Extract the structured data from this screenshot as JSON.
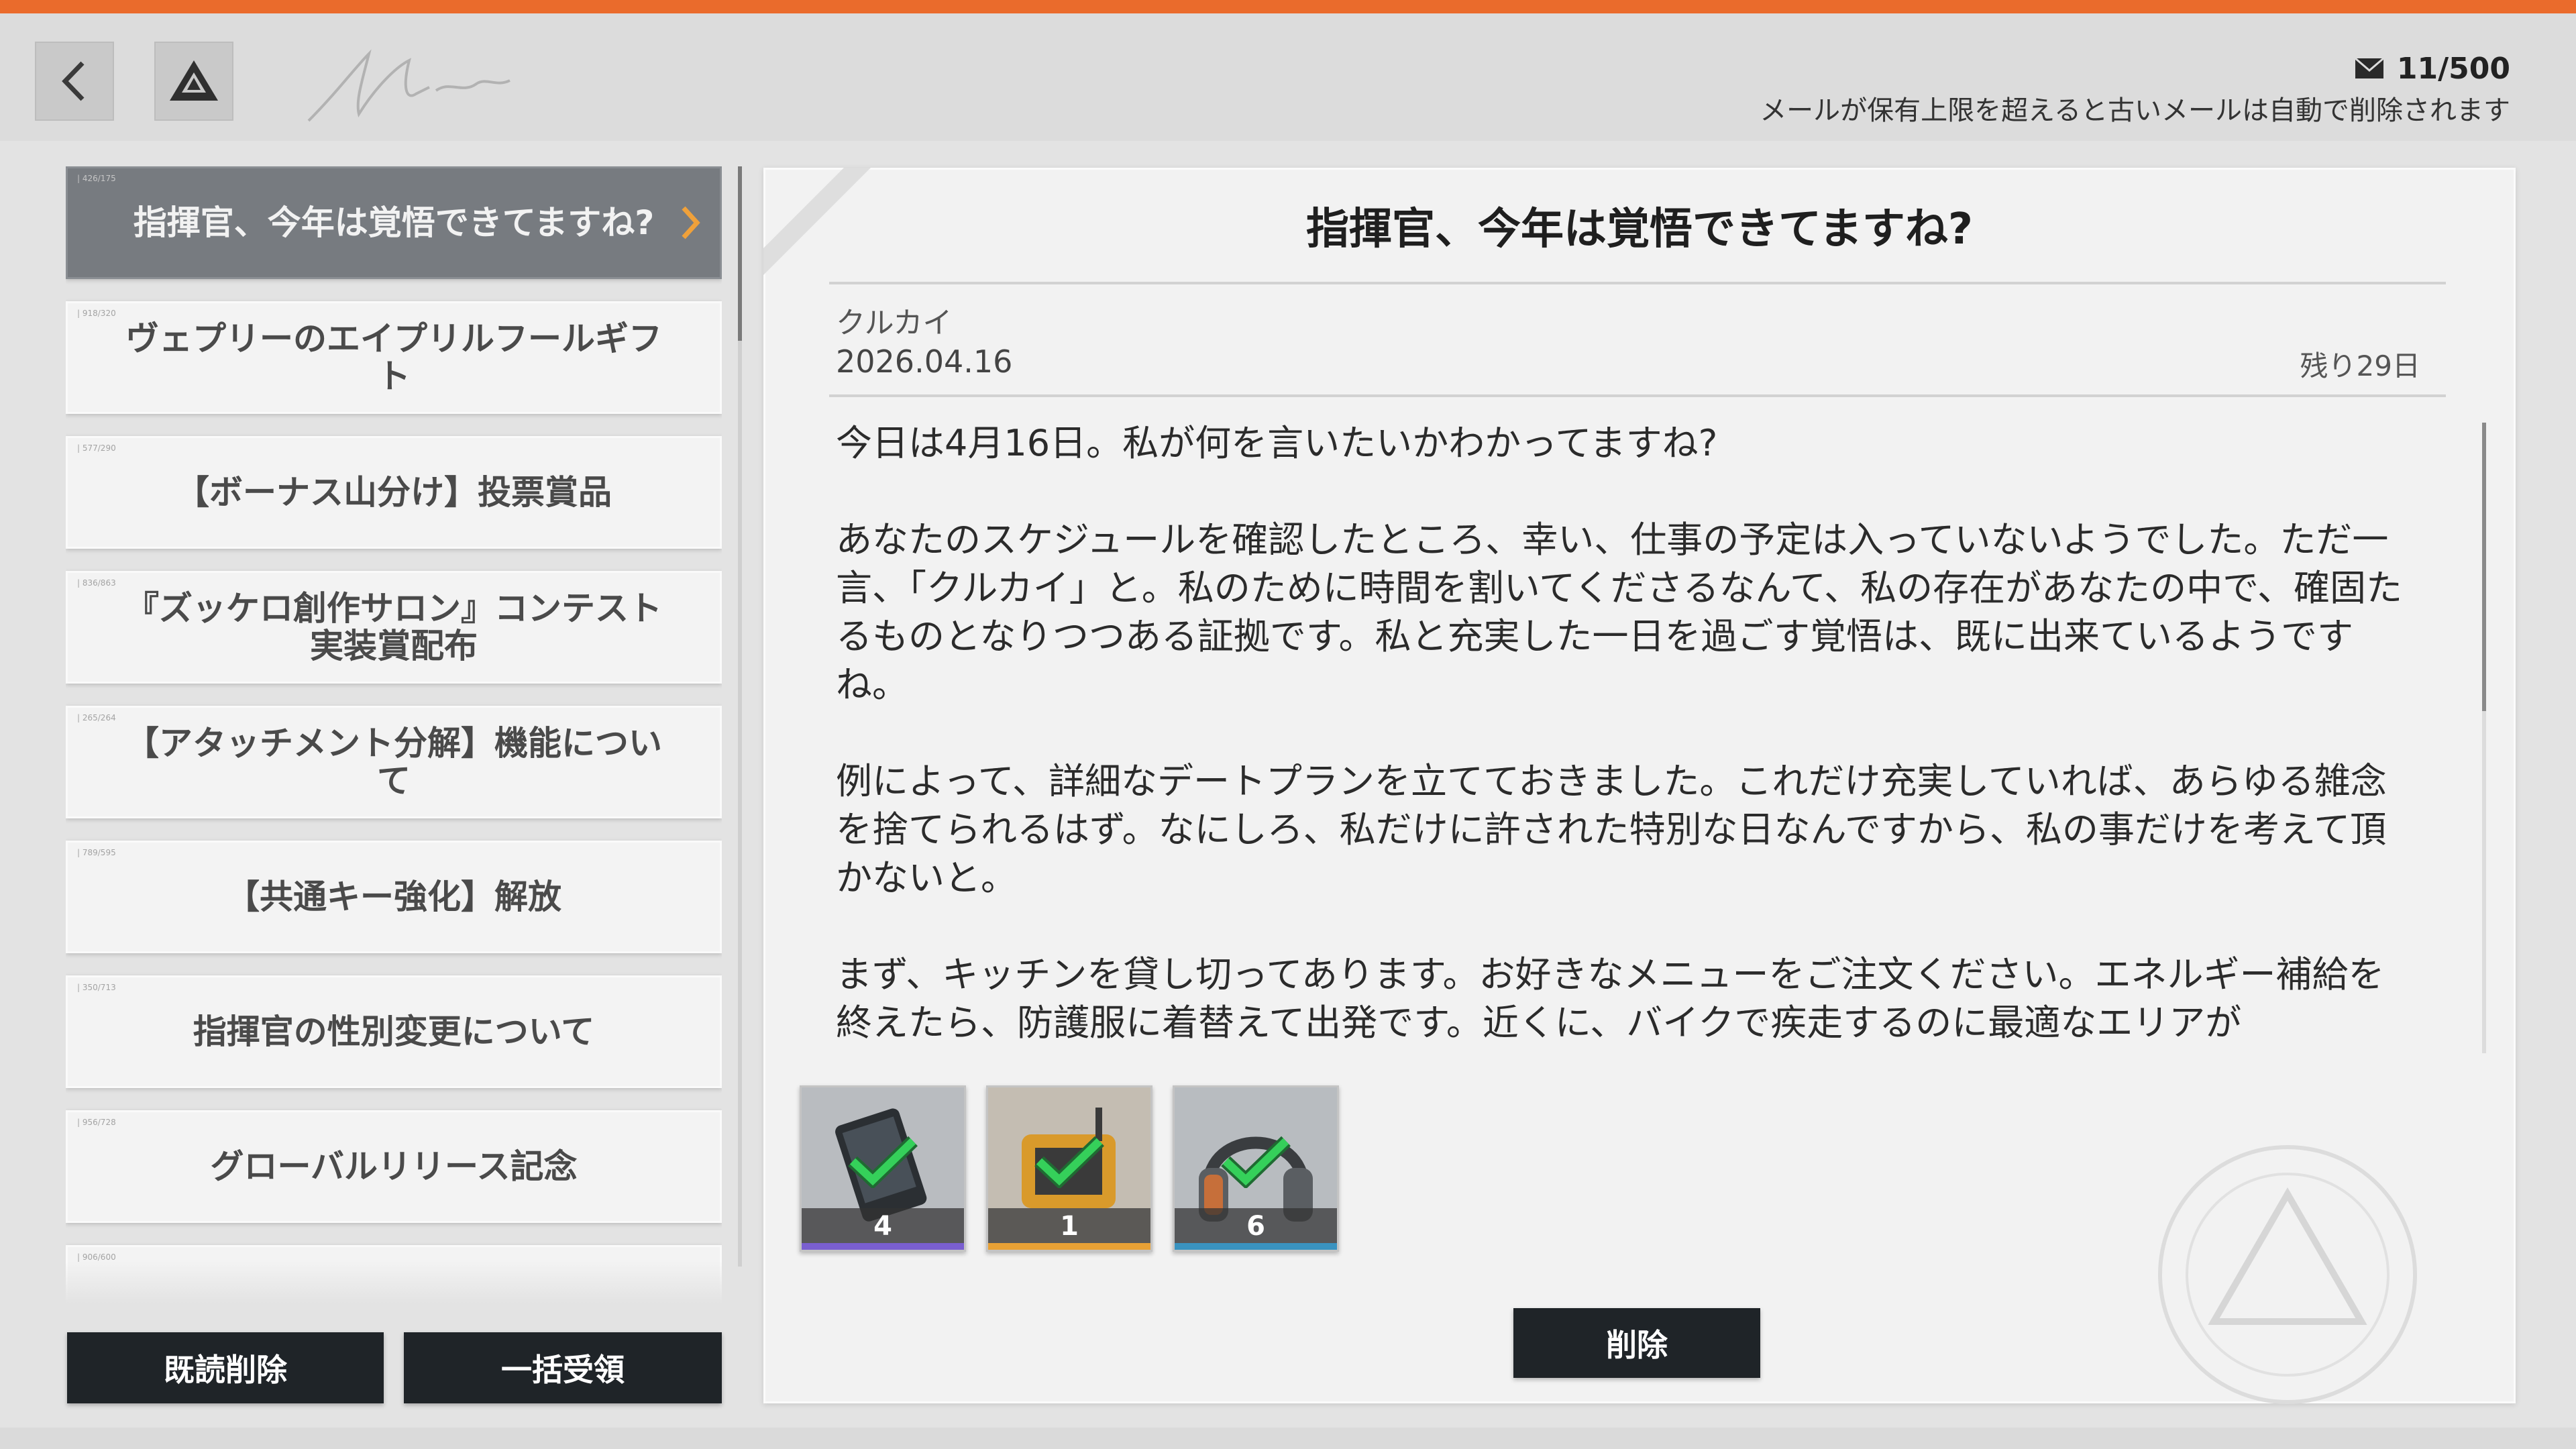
{
  "header": {
    "back_icon": "chevron-left-icon",
    "home_icon": "triangle-logo-icon",
    "mail_icon": "envelope-icon",
    "mail_count": "11/500",
    "mail_note": "メールが保有上限を超えると古いメールは自動で削除されます"
  },
  "mail_list": {
    "items": [
      {
        "title": "指揮官、今年は覚悟できてますね?",
        "tag": "| 426/175",
        "active": true
      },
      {
        "title": "ヴェプリーのエイプリルフールギフト",
        "tag": "| 918/320",
        "active": false
      },
      {
        "title": "【ボーナス山分け】投票賞品",
        "tag": "| 577/290",
        "active": false
      },
      {
        "title": "『ズッケロ創作サロン』コンテスト実装賞配布",
        "tag": "| 836/863",
        "active": false
      },
      {
        "title": "【アタッチメント分解】機能について",
        "tag": "| 265/264",
        "active": false
      },
      {
        "title": "【共通キー強化】解放",
        "tag": "| 789/595",
        "active": false
      },
      {
        "title": "指揮官の性別変更について",
        "tag": "| 350/713",
        "active": false
      },
      {
        "title": "グローバルリリース記念",
        "tag": "| 956/728",
        "active": false
      },
      {
        "title": "",
        "tag": "| 906/600",
        "active": false
      }
    ]
  },
  "buttons": {
    "delete_read": "既読削除",
    "claim_all": "一括受領",
    "delete": "削除"
  },
  "detail": {
    "title": "指揮官、今年は覚悟できてますね?",
    "sender": "クルカイ",
    "date": "2026.04.16",
    "remaining": "残り29日",
    "paragraphs": [
      "今日は4月16日。私が何を言いたいかわかってますね?",
      "あなたのスケジュールを確認したところ、幸い、仕事の予定は入っていないようでした。ただ一言、「クルカイ」と。私のために時間を割いてくださるなんて、私の存在があなたの中で、確固たるものとなりつつある証拠です。私と充実した一日を過ごす覚悟は、既に出来ているようですね。",
      "例によって、詳細なデートプランを立てておきました。これだけ充実していれば、あらゆる雑念を捨てられるはず。なにしろ、私だけに許された特別な日なんですから、私の事だけを考えて頂かないと。",
      "まず、キッチンを貸し切ってあります。お好きなメニューをご注文ください。エネルギー補給を終えたら、防護服に着替えて出発です。近くに、バイクで疾走するのに最適なエリアが"
    ]
  },
  "attachments": [
    {
      "name": "tablet-device-icon",
      "qty": "4",
      "rarity_color": "#7a5fd0",
      "claimed": true
    },
    {
      "name": "drone-device-icon",
      "qty": "1",
      "rarity_color": "#e8a135",
      "claimed": true
    },
    {
      "name": "headphones-icon",
      "qty": "6",
      "rarity_color": "#3a93c0",
      "claimed": true
    }
  ],
  "colors": {
    "accent_orange": "#ea6b2c",
    "check_green": "#35d05a",
    "button_dark": "#1f2428"
  }
}
